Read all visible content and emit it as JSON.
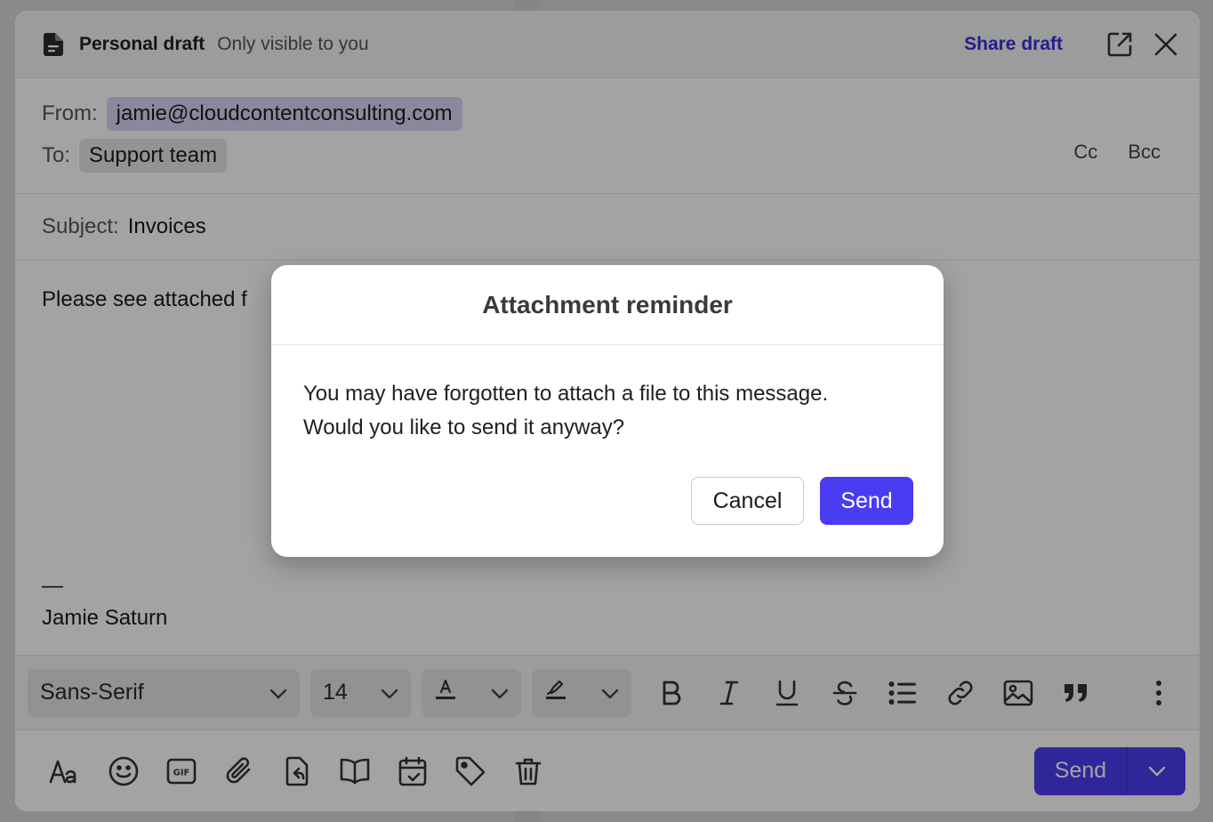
{
  "header": {
    "title": "Personal draft",
    "subtitle": "Only visible to you",
    "share_label": "Share draft"
  },
  "recipients": {
    "from_label": "From:",
    "from_value": "jamie@cloudcontentconsulting.com",
    "to_label": "To:",
    "to_value": "Support team",
    "cc_label": "Cc",
    "bcc_label": "Bcc"
  },
  "subject": {
    "label": "Subject:",
    "value": "Invoices"
  },
  "body": {
    "text": "Please see attached f",
    "signature_dash": "—",
    "signature_name": "Jamie Saturn"
  },
  "toolbar": {
    "font_family": "Sans-Serif",
    "font_size": "14"
  },
  "footer": {
    "send_label": "Send"
  },
  "modal": {
    "title": "Attachment reminder",
    "line1": "You may have forgotten to attach a file to this message.",
    "line2": "Would you like to send it anyway?",
    "cancel_label": "Cancel",
    "send_label": "Send"
  },
  "colors": {
    "accent": "#4a3cf0",
    "share_link": "#3b2fd9",
    "from_chip": "#d7d5f6"
  }
}
